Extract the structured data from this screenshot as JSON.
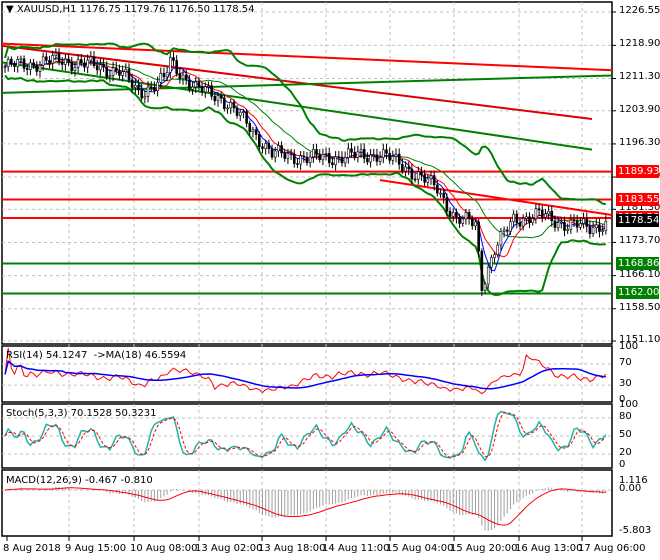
{
  "header": {
    "symbol": "XAUUSD,H1",
    "open": "1176.75",
    "high": "1179.76",
    "low": "1176.50",
    "close": "1178.54"
  },
  "chart_data": {
    "type": "candlestick",
    "title": "XAUUSD,H1",
    "ylim": [
      1151.1,
      1226.55
    ],
    "price_ticks": [
      "1226.55",
      "1218.90",
      "1211.30",
      "1203.90",
      "1196.30",
      "1188.70",
      "1181.30",
      "1173.70",
      "1166.10",
      "1158.50",
      "1151.10"
    ],
    "time_ticks": [
      "8 Aug 2018",
      "9 Aug 15:00",
      "10 Aug 08:00",
      "13 Aug 02:00",
      "13 Aug 18:00",
      "14 Aug 11:00",
      "15 Aug 04:00",
      "15 Aug 20:00",
      "16 Aug 13:00",
      "17 Aug 06:00"
    ],
    "price_path": [
      [
        0,
        1214
      ],
      [
        18,
        1215.5
      ],
      [
        36,
        1213
      ],
      [
        42,
        1208
      ],
      [
        50,
        1211
      ],
      [
        52,
        1215
      ],
      [
        60,
        1209
      ],
      [
        68,
        1207
      ],
      [
        76,
        1201
      ],
      [
        84,
        1194
      ],
      [
        96,
        1193
      ],
      [
        110,
        1193.5
      ],
      [
        118,
        1194
      ],
      [
        126,
        1191
      ],
      [
        136,
        1186
      ],
      [
        142,
        1179
      ],
      [
        148,
        1178
      ],
      [
        150,
        1164
      ],
      [
        154,
        1172
      ],
      [
        160,
        1179
      ],
      [
        168,
        1180
      ],
      [
        176,
        1178
      ],
      [
        184,
        1177
      ],
      [
        190,
        1178.54
      ]
    ],
    "levels": [
      {
        "price": "1189.93",
        "color": "#ff0000"
      },
      {
        "price": "1183.55",
        "color": "#ff0000"
      },
      {
        "price": "1179.30",
        "color": "#ff0000"
      },
      {
        "price": "1168.86",
        "color": "#008000"
      },
      {
        "price": "1162.00",
        "color": "#008000"
      }
    ],
    "current_price": "1178.54",
    "rsi": {
      "label": "RSI(14) 54.1247",
      "ma_label": "->MA(18) 46.5594",
      "ticks": [
        "100",
        "70",
        "30",
        "0"
      ]
    },
    "stoch": {
      "label": "Stoch(5,3,3) 70.1528 50.3231",
      "ticks": [
        "100",
        "80",
        "50",
        "20",
        "0"
      ]
    },
    "macd": {
      "label": "MACD(12,26,9) -0.467 -0.810",
      "ticks": [
        "1.116",
        "0.00",
        "-5.803"
      ],
      "range": [
        -5.803,
        1.116
      ]
    }
  }
}
